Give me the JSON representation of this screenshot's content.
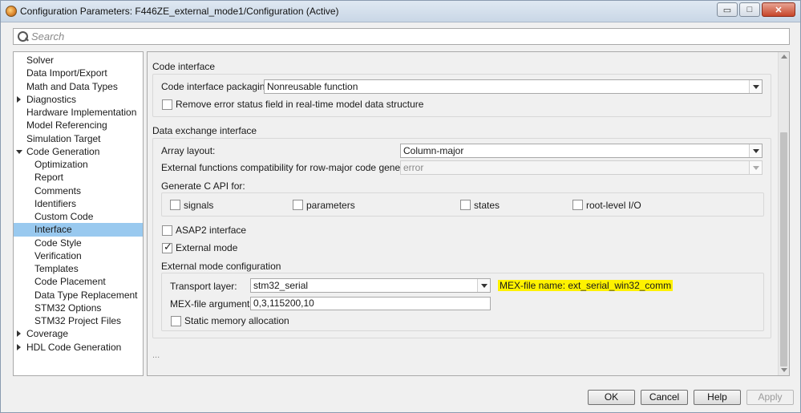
{
  "window": {
    "title": "Configuration Parameters: F446ZE_external_mode1/Configuration (Active)",
    "controls": {
      "minimize": "▭",
      "maximize": "□",
      "close": "✕"
    }
  },
  "search": {
    "placeholder": "Search"
  },
  "tree": {
    "items": [
      {
        "label": "Solver"
      },
      {
        "label": "Data Import/Export"
      },
      {
        "label": "Math and Data Types"
      },
      {
        "label": "Diagnostics"
      },
      {
        "label": "Hardware Implementation"
      },
      {
        "label": "Model Referencing"
      },
      {
        "label": "Simulation Target"
      },
      {
        "label": "Code Generation"
      },
      {
        "label": "Optimization"
      },
      {
        "label": "Report"
      },
      {
        "label": "Comments"
      },
      {
        "label": "Identifiers"
      },
      {
        "label": "Custom Code"
      },
      {
        "label": "Interface"
      },
      {
        "label": "Code Style"
      },
      {
        "label": "Verification"
      },
      {
        "label": "Templates"
      },
      {
        "label": "Code Placement"
      },
      {
        "label": "Data Type Replacement"
      },
      {
        "label": "STM32 Options"
      },
      {
        "label": "STM32 Project Files"
      },
      {
        "label": "Coverage"
      },
      {
        "label": "HDL Code Generation"
      }
    ]
  },
  "code_interface": {
    "title": "Code interface",
    "packaging_label": "Code interface packaging:",
    "packaging_value": "Nonreusable function",
    "remove_error_label": "Remove error status field in real-time model data structure"
  },
  "data_exchange": {
    "title": "Data exchange interface",
    "array_layout_label": "Array layout:",
    "array_layout_value": "Column-major",
    "ext_funcs_label": "External functions compatibility for row-major code generation:",
    "ext_funcs_value": "error",
    "c_api_label": "Generate C API for:",
    "c_api_signals": "signals",
    "c_api_parameters": "parameters",
    "c_api_states": "states",
    "c_api_rootio": "root-level I/O",
    "asap2_label": "ASAP2 interface",
    "external_mode_label": "External mode",
    "ext_mode_config_title": "External mode configuration",
    "transport_label": "Transport layer:",
    "transport_value": "stm32_serial",
    "mex_file_name": "MEX-file name:  ext_serial_win32_comm",
    "mex_args_label": "MEX-file arguments:",
    "mex_args_value": "0,3,115200,10",
    "static_mem_label": "Static memory allocation",
    "ellipsis": "..."
  },
  "buttons": {
    "ok": "OK",
    "cancel": "Cancel",
    "help": "Help",
    "apply": "Apply"
  },
  "colors": {
    "selection": "#99c9ef",
    "highlight": "#fff200"
  }
}
